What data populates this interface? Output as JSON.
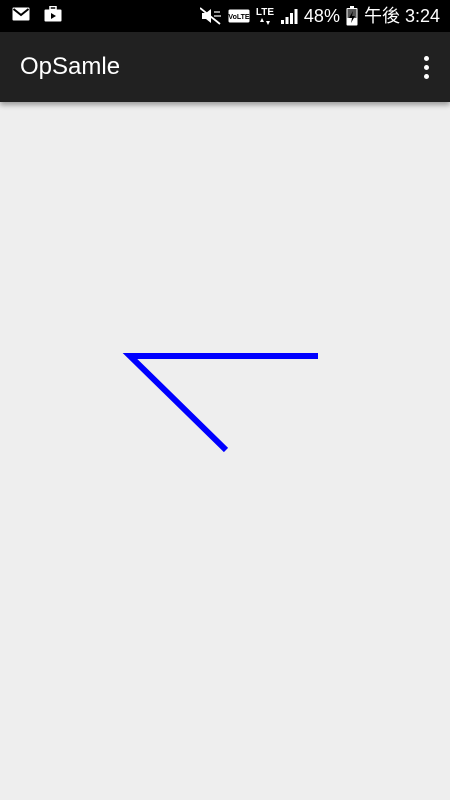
{
  "status_bar": {
    "battery_percent": "48%",
    "time": "午後 3:24",
    "volte_label": "VoLTE",
    "lte_label": "LTE",
    "icons": [
      "mail-icon",
      "briefcase-icon",
      "mute-icon",
      "volte-icon",
      "lte-icon",
      "signal-icon",
      "battery-charging-icon"
    ]
  },
  "app_bar": {
    "title": "OpSamle",
    "overflow_icon": "more-vert-icon"
  },
  "canvas": {
    "stroke_color": "#0000ff"
  },
  "colors": {
    "status_bar_bg": "#000000",
    "app_bar_bg": "#212121",
    "canvas_bg": "#eeeeee"
  }
}
